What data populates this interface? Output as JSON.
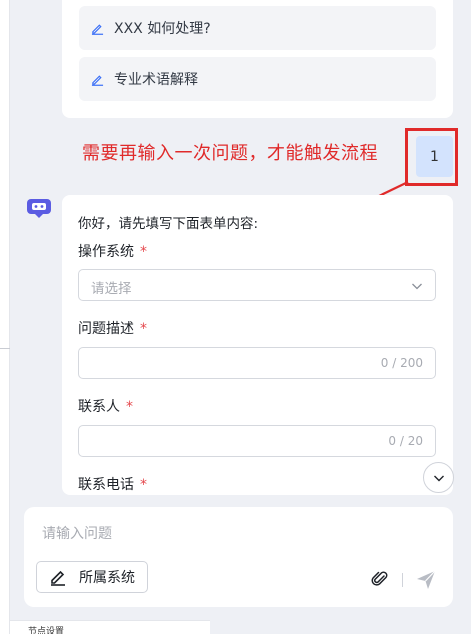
{
  "suggestions": [
    {
      "label": "XXX 如何处理?"
    },
    {
      "label": "专业术语解释"
    }
  ],
  "annotation": {
    "text": "需要再输入一次问题，才能触发流程",
    "color": "#e02a2a"
  },
  "user_message": {
    "text": "1"
  },
  "bot": {
    "greeting": "你好，请先填写下面表单内容:",
    "fields": [
      {
        "label": "操作系统",
        "required_mark": "*",
        "type": "select",
        "placeholder": "请选择"
      },
      {
        "label": "问题描述",
        "required_mark": "*",
        "type": "text",
        "counter": "0 / 200"
      },
      {
        "label": "联系人",
        "required_mark": "*",
        "type": "text",
        "counter": "0 / 20"
      },
      {
        "label": "联系电话",
        "required_mark": "*",
        "type": "text"
      }
    ]
  },
  "composer": {
    "placeholder": "请输入问题",
    "system_button_label": "所属系统"
  },
  "footer": {
    "label": "节点设置"
  },
  "colors": {
    "accent": "#3a6ff7",
    "user_bubble": "#d3e3fd",
    "required": "#e5484d"
  },
  "icons": [
    "edit-icon",
    "bot-icon",
    "chevron-down-icon",
    "arrow-down-icon",
    "pen-icon",
    "paperclip-icon",
    "send-icon"
  ]
}
